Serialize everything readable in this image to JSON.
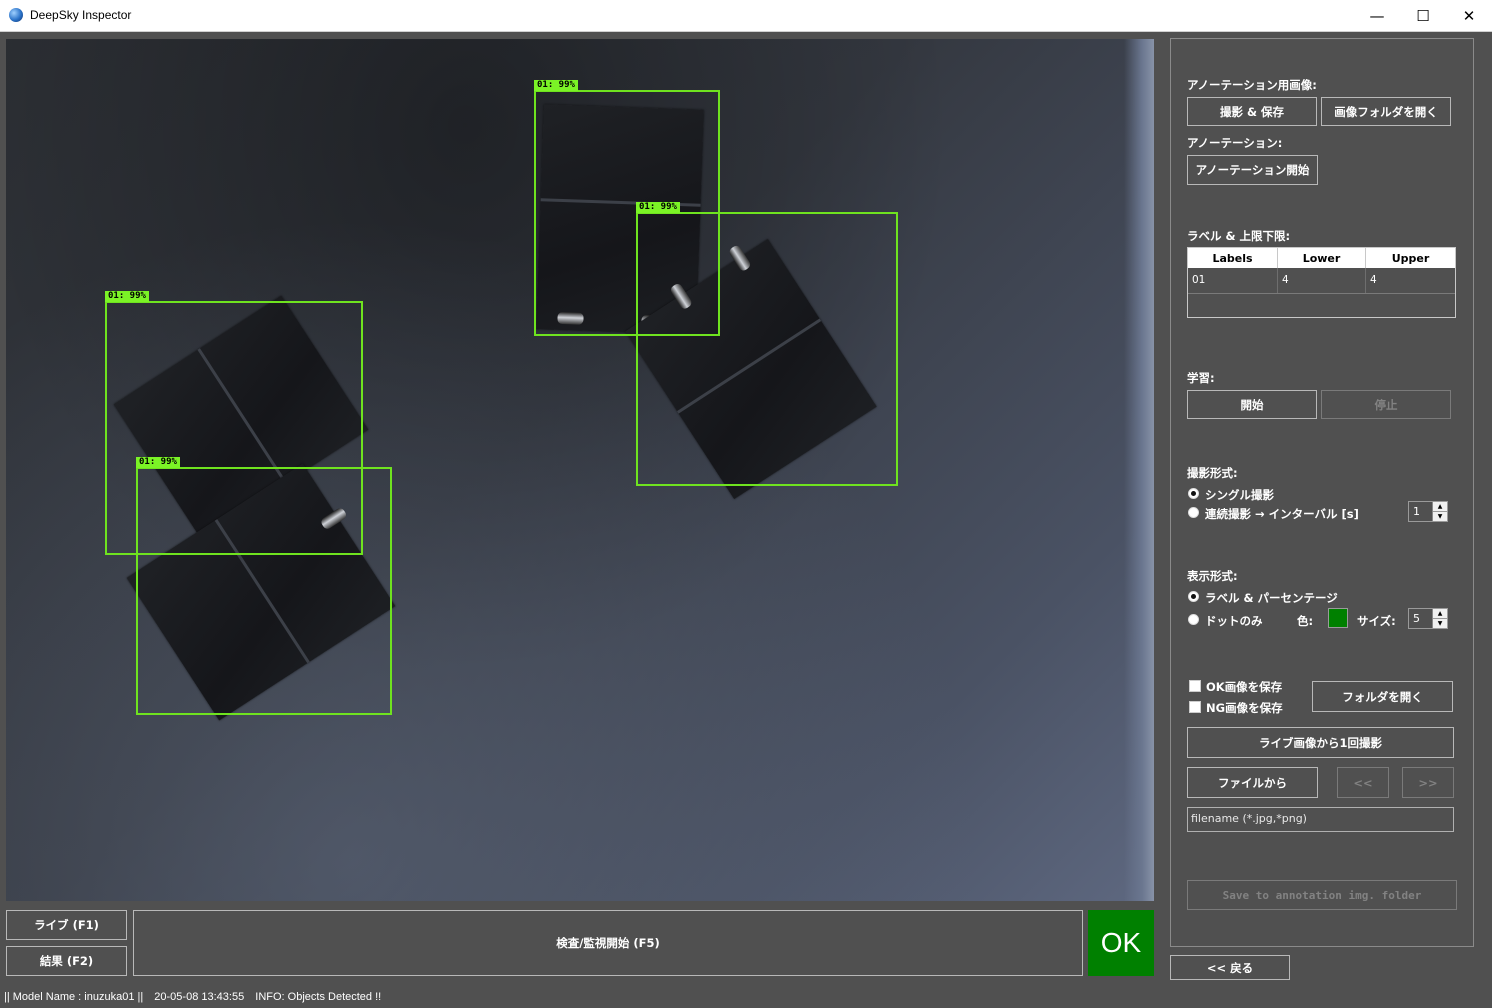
{
  "window": {
    "title": "DeepSky Inspector",
    "controls": {
      "minimize": "—",
      "maximize": "☐",
      "close": "✕"
    }
  },
  "viewport": {
    "detections": [
      {
        "label": "01: 99%"
      },
      {
        "label": "01: 99%"
      },
      {
        "label": "01: 99%"
      },
      {
        "label": "01: 99%"
      }
    ],
    "box_color": "#6fe31f"
  },
  "panel": {
    "annotation_image_label": "アノーテーション用画像:",
    "capture_save_button": "撮影 & 保存",
    "open_image_folder_button": "画像フォルダを開く",
    "annotation_label": "アノーテーション:",
    "annotation_start_button": "アノーテーション開始",
    "labels_limits_label": "ラベル & 上限下限:",
    "table": {
      "headers": [
        "Labels",
        "Lower",
        "Upper"
      ],
      "rows": [
        [
          "01",
          "4",
          "4"
        ]
      ]
    },
    "training_label": "学習:",
    "train_start_button": "開始",
    "train_stop_button": "停止",
    "capture_mode_label": "撮影形式:",
    "capture_mode_options": [
      "シングル撮影",
      "連続撮影 → インターバル [s]"
    ],
    "interval_value": "1",
    "display_mode_label": "表示形式:",
    "display_mode_options": [
      "ラベル & パーセンテージ",
      "ドットのみ"
    ],
    "color_label": "色:",
    "dot_color": "#008000",
    "size_label": "サイズ:",
    "size_value": "5",
    "save_ok_label": "OK画像を保存",
    "save_ng_label": "NG画像を保存",
    "open_folder_button": "フォルダを開く",
    "capture_once_button": "ライブ画像から1回撮影",
    "from_file_button": "ファイルから",
    "prev_button": "<<",
    "next_button": ">>",
    "filename_placeholder": "filename (*.jpg,*png)",
    "save_annotation_button": "Save to annotation img. folder"
  },
  "back_button": "<< 戻る",
  "bottom": {
    "live_button": "ライブ (F1)",
    "result_button": "結果 (F2)",
    "inspect_button": "検査/監視開始 (F5)",
    "result_status": "OK",
    "result_color": "#008000"
  },
  "statusbar": {
    "model": "|| Model Name : inuzuka01 ||",
    "timestamp": "20-05-08 13:43:55",
    "info": "INFO:  Objects Detected !!"
  }
}
